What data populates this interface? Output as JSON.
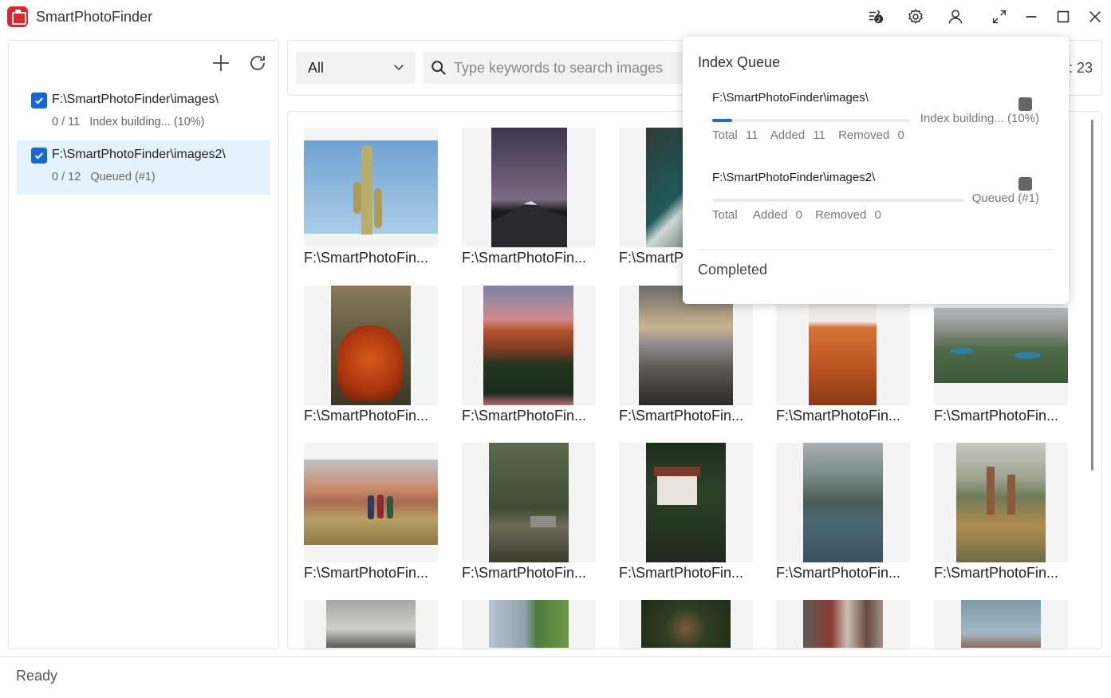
{
  "app": {
    "title": "SmartPhotoFinder"
  },
  "titlebar_icons": [
    "tasks-badge-icon",
    "settings-icon",
    "user-icon",
    "fullscreen-icon",
    "minimize-icon",
    "maximize-icon",
    "close-icon"
  ],
  "folders": [
    {
      "path": "F:\\SmartPhotoFinder\\images\\",
      "count": "0 / 11",
      "state": "Index building... (10%)",
      "checked": true
    },
    {
      "path": "F:\\SmartPhotoFinder\\images2\\",
      "count": "0 / 12",
      "state": "Queued (#1)",
      "checked": true
    }
  ],
  "filter": {
    "type_value": "All",
    "search_placeholder": "Type keywords to search images",
    "count_text": ": 23"
  },
  "gallery": {
    "caption": "F:\\SmartPhotoFin...",
    "thumbnails": [
      {
        "label": "F:\\SmartPhotoFin...",
        "scene": "cactus"
      },
      {
        "label": "F:\\SmartPhotoFin...",
        "scene": "night-mountain"
      },
      {
        "label": "F:\\SmartP",
        "scene": "river"
      },
      {
        "label": "",
        "scene": "hidden"
      },
      {
        "label": "",
        "scene": "hidden"
      },
      {
        "label": "F:\\SmartPhotoFin...",
        "scene": "autumn-tree"
      },
      {
        "label": "F:\\SmartPhotoFin...",
        "scene": "red-cliff"
      },
      {
        "label": "F:\\SmartPhotoFin...",
        "scene": "valley-sky"
      },
      {
        "label": "F:\\SmartPhotoFin...",
        "scene": "orange-rock"
      },
      {
        "label": "F:\\SmartPhotoFin...",
        "scene": "alpine-lake"
      },
      {
        "label": "F:\\SmartPhotoFin...",
        "scene": "hikers"
      },
      {
        "label": "F:\\SmartPhotoFin...",
        "scene": "forest-cabin"
      },
      {
        "label": "F:\\SmartPhotoFin...",
        "scene": "chalet"
      },
      {
        "label": "F:\\SmartPhotoFin...",
        "scene": "lake-paddle"
      },
      {
        "label": "F:\\SmartPhotoFin...",
        "scene": "church"
      },
      {
        "label": "",
        "scene": "cloudy-town"
      },
      {
        "label": "",
        "scene": "snowy-peak"
      },
      {
        "label": "",
        "scene": "treetops"
      },
      {
        "label": "",
        "scene": "buildings"
      },
      {
        "label": "",
        "scene": "harbor"
      }
    ]
  },
  "queue": {
    "title": "Index Queue",
    "items": [
      {
        "path": "F:\\SmartPhotoFinder\\images\\",
        "state": "Index building... (10%)",
        "progress": 0.1,
        "total_label": "Total",
        "total": "11",
        "added_label": "Added",
        "added": "11",
        "removed_label": "Removed",
        "removed": "0"
      },
      {
        "path": "F:\\SmartPhotoFinder\\images2\\",
        "state": "Queued (#1)",
        "progress": 0,
        "total_label": "Total",
        "total": "",
        "added_label": "Added",
        "added": "0",
        "removed_label": "Removed",
        "removed": "0"
      }
    ],
    "completed_label": "Completed"
  },
  "status": {
    "text": "Ready"
  },
  "colors": {
    "accent": "#1668d8",
    "brand": "#e4242c",
    "selected_bg": "#e6f2fd"
  }
}
